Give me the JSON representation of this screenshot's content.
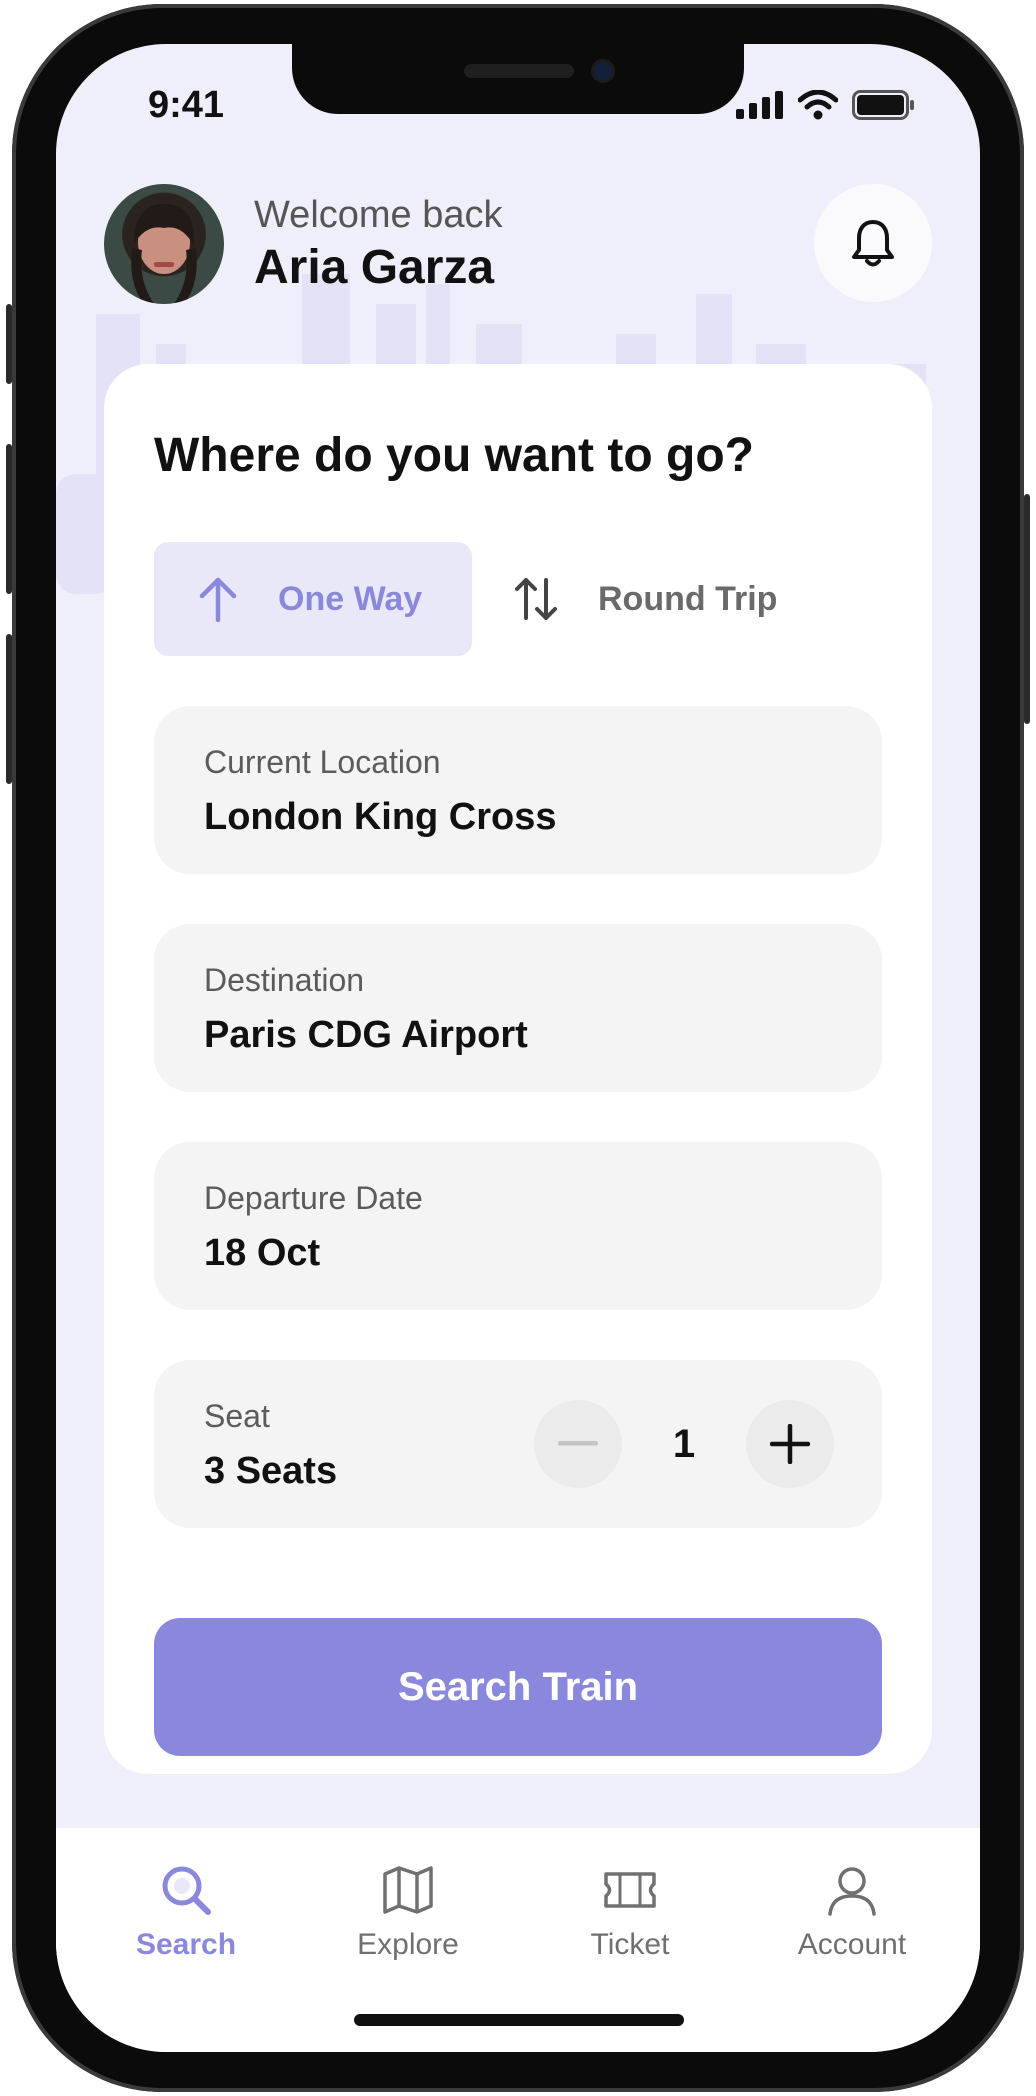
{
  "status": {
    "time": "9:41"
  },
  "header": {
    "welcome": "Welcome back",
    "name": "Aria Garza"
  },
  "card": {
    "title": "Where do you want to go?",
    "trip_options": [
      {
        "label": "One Way",
        "selected": true
      },
      {
        "label": "Round Trip",
        "selected": false
      }
    ],
    "fields": {
      "origin": {
        "label": "Current Location",
        "value": "London King Cross"
      },
      "destination": {
        "label": "Destination",
        "value": "Paris CDG Airport"
      },
      "date": {
        "label": "Departure Date",
        "value": "18 Oct"
      },
      "seat": {
        "label": "Seat",
        "value": "3 Seats",
        "count": "1"
      }
    },
    "submit_label": "Search Train"
  },
  "tabbar": {
    "items": [
      {
        "label": "Search",
        "icon": "search-icon",
        "active": true
      },
      {
        "label": "Explore",
        "icon": "map-icon",
        "active": false
      },
      {
        "label": "Ticket",
        "icon": "ticket-icon",
        "active": false
      },
      {
        "label": "Account",
        "icon": "user-icon",
        "active": false
      }
    ]
  },
  "colors": {
    "accent": "#8a88dc",
    "accent_light": "#e9e8f9",
    "background": "#efeefb",
    "field_bg": "#f4f4f4"
  }
}
